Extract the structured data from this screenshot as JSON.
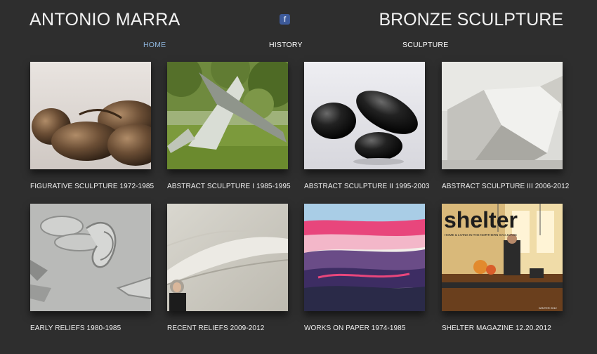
{
  "header": {
    "site_name": "ANTONIO MARRA",
    "tagline": "BRONZE SCULPTURE",
    "facebook_glyph": "f"
  },
  "nav": {
    "items": [
      {
        "label": "HOME",
        "active": true
      },
      {
        "label": "HISTORY",
        "active": false
      },
      {
        "label": "SCULPTURE",
        "active": false
      }
    ]
  },
  "gallery": {
    "items": [
      {
        "caption": "FIGURATIVE SCULPTURE  1972-1985"
      },
      {
        "caption": "ABSTRACT SCULPTURE  I  1985-1995"
      },
      {
        "caption": "ABSTRACT SCULPTURE  II  1995-2003"
      },
      {
        "caption": "ABSTRACT SCULPTURE  III  2006-2012"
      },
      {
        "caption": "EARLY RELIEFS  1980-1985"
      },
      {
        "caption": "RECENT RELIEFS  2009-2012"
      },
      {
        "caption": "WORKS ON PAPER  1974-1985"
      },
      {
        "caption": "SHELTER MAGAZINE   12.20.2012",
        "image_text": "shelter",
        "image_subtext": "HOME & LIVING IN THE NORTHERN SAN JUANS",
        "image_corner": "WINTER 2012"
      }
    ]
  },
  "colors": {
    "background": "#2e2e2e",
    "nav_active": "#8fb6dd",
    "text": "#f2f2f2",
    "facebook": "#3d5a99"
  }
}
